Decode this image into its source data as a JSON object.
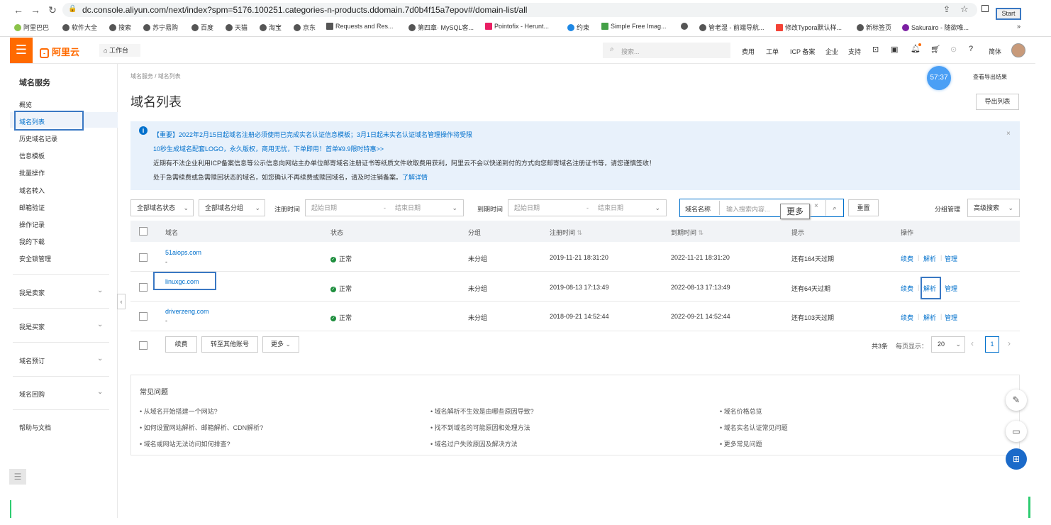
{
  "browser": {
    "url": "dc.console.aliyun.com/next/index?spm=5176.100251.categories-n-products.ddomain.7d0b4f15a7epov#/domain-list/all",
    "start_label": "Start",
    "bookmarks": [
      "阿里巴巴",
      "软件大全",
      "搜索",
      "苏宁易购",
      "百度",
      "天猫",
      "淘宝",
      "京东",
      "Requests and Res...",
      "第四章· MySQL客...",
      "Pointofix - Herunt...",
      "约束",
      "Simple Free Imag...",
      "管老湿 - 前端导航...",
      "修改Typora默认样...",
      "新标签页",
      "Sakurairo - 随欲唯..."
    ],
    "more_bookmarks": "»"
  },
  "header": {
    "logo": "阿里云",
    "workbench": "工作台",
    "search_placeholder": "搜索...",
    "nav": [
      "费用",
      "工单",
      "ICP 备案",
      "企业",
      "支持"
    ],
    "lang": "简体"
  },
  "sidebar": {
    "title": "域名服务",
    "items": [
      "概览",
      "域名列表",
      "历史域名记录",
      "信息模板",
      "批量操作",
      "域名转入",
      "邮箱验证",
      "操作记录",
      "我的下载",
      "安全锁管理"
    ],
    "groups": [
      "我是卖家",
      "我是买家",
      "域名预订",
      "域名回购"
    ],
    "help": "帮助与文档"
  },
  "main": {
    "breadcrumb": [
      "域名服务",
      "域名列表"
    ],
    "title": "域名列表",
    "timer": "57:37",
    "view_export": "查看导出结果",
    "export_btn": "导出列表",
    "notice": {
      "line1": "【重要】2022年2月15日起域名注册必须使用已完成实名认证信息模板；3月1日起未实名认证域名管理操作将受限",
      "line2": "10秒生成域名配套LOGO，永久版权，商用无忧，下单即用！首单¥9.9限时特惠>>",
      "line3": "近期有不法企业利用ICP备案信息等公示信息向网站主办单位邮寄域名注册证书等纸质文件收取费用获利，阿里云不会以快递到付的方式向您邮寄域名注册证书等，请您谨慎签收！",
      "line4": "处于急需续费或急需赎回状态的域名，如您确认不再续费或赎回域名，请及时注销备案。",
      "more": "了解详情"
    },
    "filters": {
      "status": "全部域名状态",
      "group": "全部域名分组",
      "reg_label": "注册时间",
      "exp_label": "到期时间",
      "start_date": "起始日期",
      "end_date": "结束日期",
      "name_select": "域名名称",
      "search_placeholder": "输入搜索内容...",
      "tooltip": "更多",
      "reset": "重置",
      "group_manage": "分组管理",
      "advanced": "高级搜索"
    },
    "table": {
      "headers": [
        "域名",
        "状态",
        "分组",
        "注册时间",
        "到期时间",
        "提示",
        "操作"
      ],
      "rows": [
        {
          "domain": "51aiops.com",
          "sub": "-",
          "status": "正常",
          "group": "未分组",
          "reg": "2019-11-21 18:31:20",
          "exp": "2022-11-21 18:31:20",
          "hint": "还有164天过期"
        },
        {
          "domain": "linuxgc.com",
          "sub": "-",
          "status": "正常",
          "group": "未分组",
          "reg": "2019-08-13 17:13:49",
          "exp": "2022-08-13 17:13:49",
          "hint": "还有64天过期"
        },
        {
          "domain": "driverzeng.com",
          "sub": "-",
          "status": "正常",
          "group": "未分组",
          "reg": "2018-09-21 14:52:44",
          "exp": "2022-09-21 14:52:44",
          "hint": "还有103天过期"
        }
      ],
      "actions": [
        "续费",
        "解析",
        "管理"
      ]
    },
    "footer": {
      "renew": "续费",
      "transfer": "转至其他账号",
      "more": "更多",
      "total": "共3条",
      "per_page": "每页显示：",
      "page_size": "20",
      "page": "1"
    },
    "faq": {
      "title": "常见问题",
      "items": [
        "• 从域名开始搭建一个网站?",
        "• 如何设置网站解析、邮箱解析、CDN解析?",
        "• 域名或网站无法访问如何排查?",
        "• 域名解析不生效是由哪些原因导致?",
        "• 找不到域名的可能原因和处理方法",
        "• 域名过户失败原因及解决方法",
        "• 域名价格总览",
        "• 域名实名认证常见问题",
        "• 更多常见问题"
      ]
    }
  },
  "colors": {
    "brand": "#ff6a00",
    "link": "#0070cc",
    "notice_bg": "#e8f1fb",
    "ok": "#1e8e3e",
    "float": "#1b6ac9"
  }
}
